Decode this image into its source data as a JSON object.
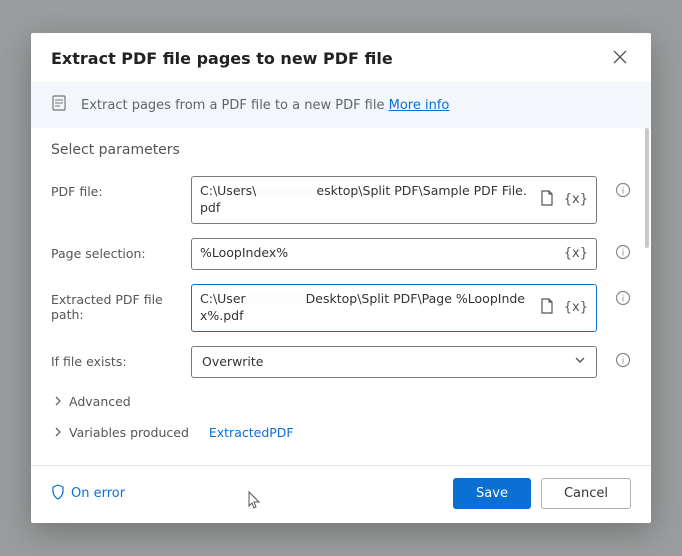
{
  "dialog": {
    "title": "Extract PDF file pages to new PDF file",
    "banner_text": "Extract pages from a PDF file to a new PDF file",
    "more_info": "More info"
  },
  "section_title": "Select parameters",
  "fields": {
    "pdf_file": {
      "label": "PDF file:",
      "value_prefix": "C:\\Users\\",
      "value_suffix": "esktop\\Split PDF\\Sample PDF File.pdf"
    },
    "page_selection": {
      "label": "Page selection:",
      "value": "%LoopIndex%"
    },
    "extracted_path": {
      "label": "Extracted PDF file path:",
      "value_prefix": "C:\\User",
      "value_suffix": "Desktop\\Split PDF\\Page %LoopIndex%.pdf"
    },
    "if_exists": {
      "label": "If file exists:",
      "value": "Overwrite"
    }
  },
  "expand": {
    "advanced": "Advanced",
    "vars_produced": "Variables produced",
    "var_name": "ExtractedPDF"
  },
  "footer": {
    "on_error": "On error",
    "save": "Save",
    "cancel": "Cancel"
  }
}
